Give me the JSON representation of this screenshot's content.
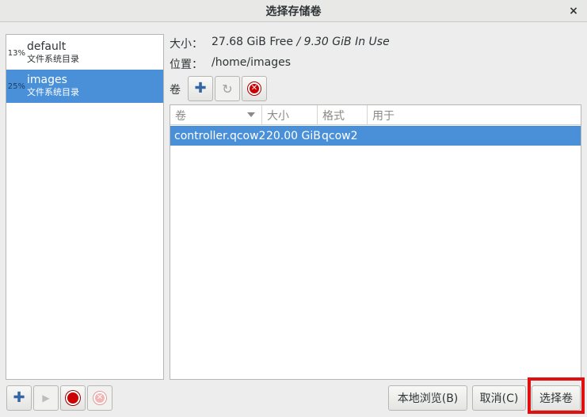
{
  "window": {
    "title": "选择存储卷",
    "close_glyph": "×"
  },
  "pools": [
    {
      "usage": "13%",
      "name": "default",
      "type": "文件系统目录",
      "selected": false
    },
    {
      "usage": "25%",
      "name": "images",
      "type": "文件系统目录",
      "selected": true
    }
  ],
  "info": {
    "size_label": "大小：",
    "size_free": "27.68 GiB Free",
    "size_sep": " / ",
    "size_used": "9.30 GiB In Use",
    "location_label": "位置：",
    "location_value": "/home/images"
  },
  "volumes_toolbar": {
    "label": "卷",
    "icons": [
      "add-volume-icon",
      "refresh-icon",
      "delete-volume-icon"
    ]
  },
  "volume_table": {
    "columns": [
      "卷",
      "大小",
      "格式",
      "用于"
    ],
    "rows": [
      {
        "name": "controller.qcow2",
        "size": "20.00 GiB",
        "format": "qcow2",
        "used_by": ""
      }
    ]
  },
  "pool_toolbar": {
    "icons": [
      "add-pool-icon",
      "start-pool-icon",
      "stop-pool-icon",
      "delete-pool-icon"
    ]
  },
  "buttons": {
    "browse_local": "本地浏览(B)",
    "cancel": "取消(C)",
    "choose_volume": "选择卷"
  },
  "colors": {
    "selection": "#4a90d9",
    "highlight_box": "#e01010",
    "stop_red": "#cc0000"
  }
}
